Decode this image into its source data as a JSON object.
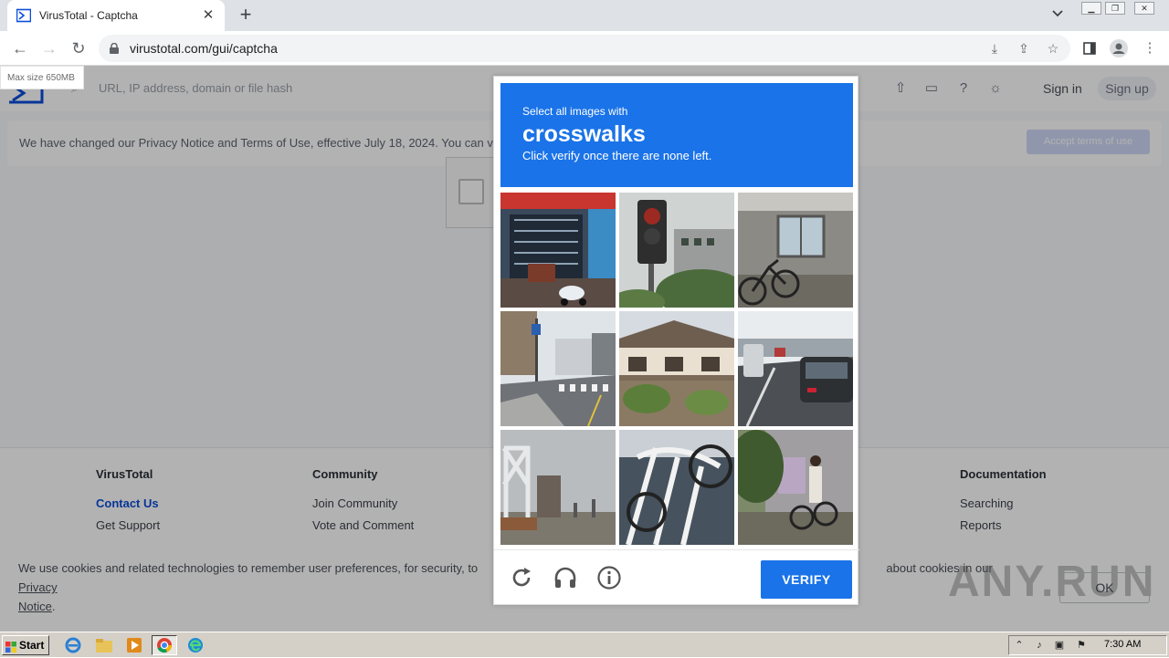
{
  "browser": {
    "tab_title": "VirusTotal - Captcha",
    "url": "virustotal.com/gui/captcha"
  },
  "vt": {
    "max_size": "Max size 650MB",
    "search_placeholder": "URL, IP address, domain or file hash",
    "sign_in": "Sign in",
    "sign_up": "Sign up",
    "notice_text": "We have changed our Privacy Notice and Terms of Use, effective July 18, 2024. You can v",
    "accept_terms": "Accept terms of use"
  },
  "footer": {
    "col1_head": "VirusTotal",
    "col1_links": [
      "Contact Us",
      "Get Support"
    ],
    "col2_head": "Community",
    "col2_links": [
      "Join Community",
      "Vote and Comment"
    ],
    "col3_head": "Documentation",
    "col3_links": [
      "Searching",
      "Reports"
    ]
  },
  "cookie": {
    "text_start": "We use cookies and related technologies to remember user preferences, for security, to",
    "text_end": "about cookies in our",
    "privacy_link": "Privacy",
    "notice_link": "Notice",
    "ok": "OK",
    "watermark": "ANY.RUN"
  },
  "captcha": {
    "instruction_small": "Select all images with",
    "target": "crosswalks",
    "instruction_sub": "Click verify once there are none left.",
    "verify": "VERIFY",
    "tiles": [
      "storefront-with-scooter",
      "traffic-light",
      "bicycle-in-garage",
      "street-with-crosswalk",
      "houses",
      "cars-on-road",
      "bridge",
      "metal-railing",
      "person-with-bicycle"
    ]
  },
  "taskbar": {
    "start": "Start",
    "clock": "7:30 AM"
  },
  "colors": {
    "captcha_blue": "#1a73e8",
    "vt_blue": "#0b4dda"
  }
}
